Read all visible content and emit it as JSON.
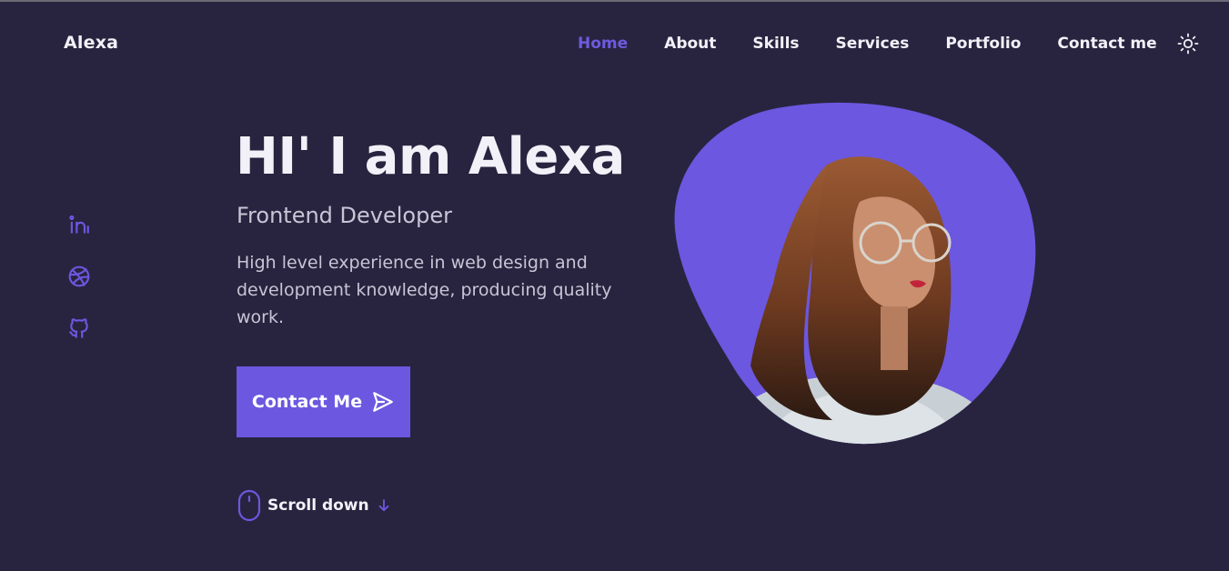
{
  "brand": {
    "name": "Alexa"
  },
  "nav": {
    "items": [
      {
        "label": "Home",
        "active": true
      },
      {
        "label": "About",
        "active": false
      },
      {
        "label": "Skills",
        "active": false
      },
      {
        "label": "Services",
        "active": false
      },
      {
        "label": "Portfolio",
        "active": false
      },
      {
        "label": "Contact me",
        "active": false
      }
    ],
    "theme_icon": "sun-icon"
  },
  "social": {
    "icons": [
      "linkedin-icon",
      "dribbble-icon",
      "github-icon"
    ]
  },
  "hero": {
    "title": "HI' I am Alexa",
    "subtitle": "Frontend Developer",
    "description": "High level experience in web design and development knowledge, producing quality work.",
    "cta_label": "Contact Me",
    "cta_icon": "send-icon",
    "portrait_icon": "profile-portrait"
  },
  "scroll": {
    "label": "Scroll down",
    "mouse_icon": "mouse-icon",
    "arrow_icon": "arrow-down-icon"
  },
  "colors": {
    "background": "#28243f",
    "accent": "#6c57e0",
    "text": "#f2f1f8",
    "muted_text": "#c7c5d6"
  }
}
